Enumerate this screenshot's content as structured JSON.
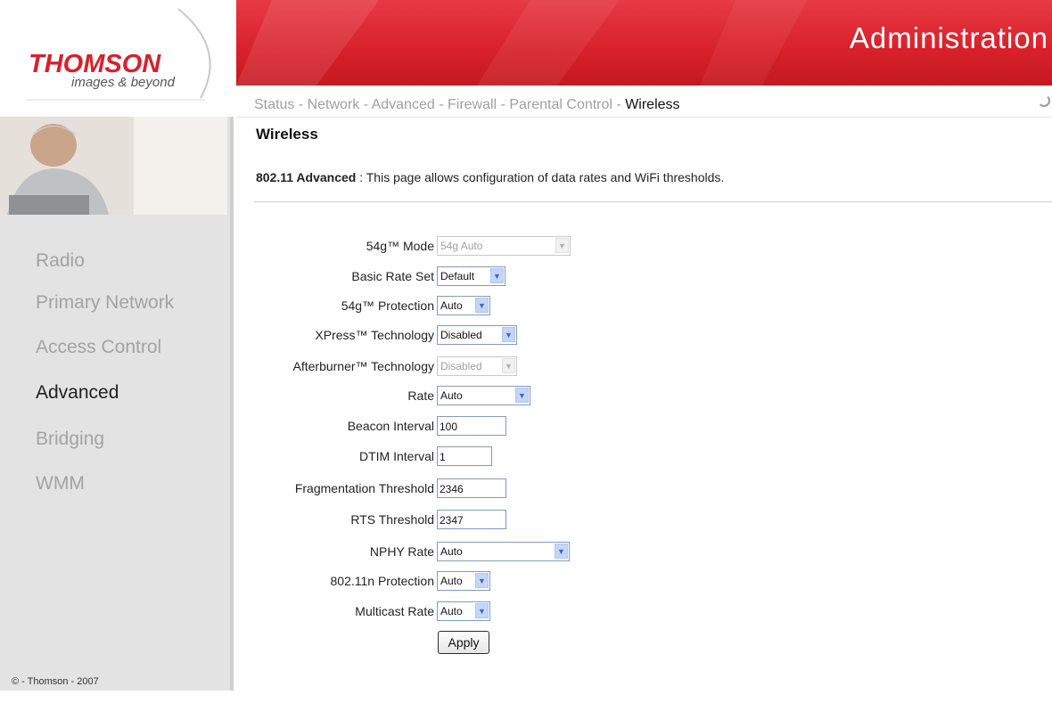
{
  "header": {
    "logo_text": "THOMSON",
    "logo_tagline": "images & beyond",
    "banner_title": "Administration"
  },
  "nav": {
    "links": [
      {
        "label": "Status",
        "active": false
      },
      {
        "label": "Network",
        "active": false
      },
      {
        "label": "Advanced",
        "active": false
      },
      {
        "label": "Firewall",
        "active": false
      },
      {
        "label": "Parental Control",
        "active": false
      },
      {
        "label": "Wireless",
        "active": true
      }
    ],
    "separator": " - "
  },
  "sidebar": {
    "items": [
      {
        "label": "Radio",
        "active": false
      },
      {
        "label": "Primary Network",
        "active": false
      },
      {
        "label": "Access Control",
        "active": false
      },
      {
        "label": "Advanced",
        "active": true
      },
      {
        "label": "Bridging",
        "active": false
      },
      {
        "label": "WMM",
        "active": false
      }
    ],
    "copyright": "© - Thomson - 2007"
  },
  "main": {
    "title": "Wireless",
    "desc_strong": "802.11 Advanced",
    "desc_text": " :  This page allows configuration of data rates and WiFi thresholds.",
    "fields": {
      "mode54g": {
        "label": "54g™ Mode",
        "value": "54g Auto",
        "disabled": true
      },
      "basic_rate_set": {
        "label": "Basic Rate Set",
        "value": "Default"
      },
      "protection54g": {
        "label": "54g™ Protection",
        "value": "Auto"
      },
      "xpress": {
        "label": "XPress™ Technology",
        "value": "Disabled"
      },
      "afterburner": {
        "label": "Afterburner™ Technology",
        "value": "Disabled",
        "disabled": true
      },
      "rate": {
        "label": "Rate",
        "value": "Auto"
      },
      "beacon_interval": {
        "label": "Beacon Interval",
        "value": "100"
      },
      "dtim_interval": {
        "label": "DTIM Interval",
        "value": "1"
      },
      "frag_threshold": {
        "label": "Fragmentation Threshold",
        "value": "2346"
      },
      "rts_threshold": {
        "label": "RTS Threshold",
        "value": "2347"
      },
      "nphy_rate": {
        "label": "NPHY Rate",
        "value": "Auto"
      },
      "protection_11n": {
        "label": "802.11n Protection",
        "value": "Auto"
      },
      "multicast_rate": {
        "label": "Multicast Rate",
        "value": "Auto"
      }
    },
    "apply_label": "Apply"
  },
  "colors": {
    "brand_red": "#d8202a",
    "sidebar_bg": "#e3e3e3",
    "inactive_text": "#a3a3a3"
  }
}
